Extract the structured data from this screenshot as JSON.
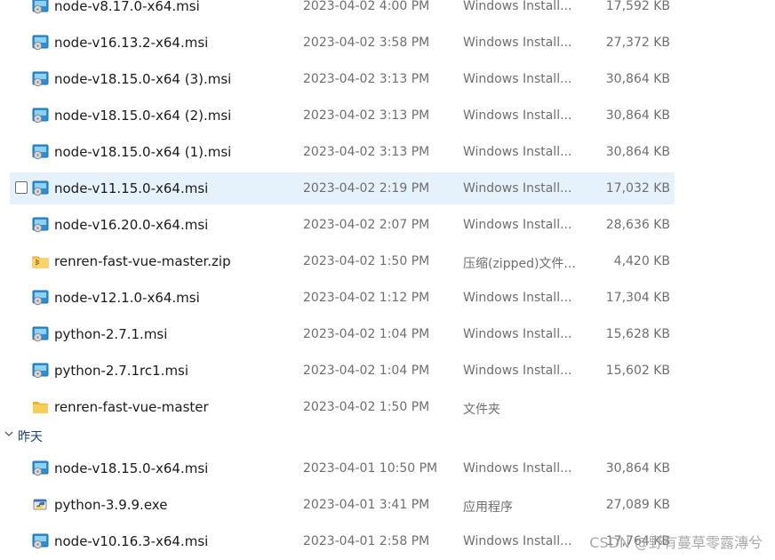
{
  "group": {
    "label": "昨天"
  },
  "files": [
    {
      "name": "node-v8.17.0-x64.msi",
      "date": "2023-04-02 4:00 PM",
      "type": "Windows Install...",
      "size": "17,592 KB",
      "icon": "msi-icon"
    },
    {
      "name": "node-v16.13.2-x64.msi",
      "date": "2023-04-02 3:58 PM",
      "type": "Windows Install...",
      "size": "27,372 KB",
      "icon": "msi-icon"
    },
    {
      "name": "node-v18.15.0-x64 (3).msi",
      "date": "2023-04-02 3:13 PM",
      "type": "Windows Install...",
      "size": "30,864 KB",
      "icon": "msi-icon"
    },
    {
      "name": "node-v18.15.0-x64 (2).msi",
      "date": "2023-04-02 3:13 PM",
      "type": "Windows Install...",
      "size": "30,864 KB",
      "icon": "msi-icon"
    },
    {
      "name": "node-v18.15.0-x64 (1).msi",
      "date": "2023-04-02 3:13 PM",
      "type": "Windows Install...",
      "size": "30,864 KB",
      "icon": "msi-icon"
    },
    {
      "name": "node-v11.15.0-x64.msi",
      "date": "2023-04-02 2:19 PM",
      "type": "Windows Install...",
      "size": "17,032 KB",
      "icon": "msi-icon",
      "hover": true
    },
    {
      "name": "node-v16.20.0-x64.msi",
      "date": "2023-04-02 2:07 PM",
      "type": "Windows Install...",
      "size": "28,636 KB",
      "icon": "msi-icon"
    },
    {
      "name": "renren-fast-vue-master.zip",
      "date": "2023-04-02 1:50 PM",
      "type": "压缩(zipped)文件...",
      "size": "4,420 KB",
      "icon": "zip-folder-icon"
    },
    {
      "name": "node-v12.1.0-x64.msi",
      "date": "2023-04-02 1:12 PM",
      "type": "Windows Install...",
      "size": "17,304 KB",
      "icon": "msi-icon"
    },
    {
      "name": "python-2.7.1.msi",
      "date": "2023-04-02 1:04 PM",
      "type": "Windows Install...",
      "size": "15,628 KB",
      "icon": "msi-icon"
    },
    {
      "name": "python-2.7.1rc1.msi",
      "date": "2023-04-02 1:04 PM",
      "type": "Windows Install...",
      "size": "15,602 KB",
      "icon": "msi-icon"
    },
    {
      "name": "renren-fast-vue-master",
      "date": "2023-04-02 1:50 PM",
      "type": "文件夹",
      "size": "",
      "icon": "folder-icon"
    },
    {
      "name": "node-v18.15.0-x64.msi",
      "date": "2023-04-01 10:50 PM",
      "type": "Windows Install...",
      "size": "30,864 KB",
      "icon": "msi-icon"
    },
    {
      "name": "python-3.9.9.exe",
      "date": "2023-04-01 3:41 PM",
      "type": "应用程序",
      "size": "27,089 KB",
      "icon": "exe-icon"
    },
    {
      "name": "node-v10.16.3-x64.msi",
      "date": "2023-04-01 2:58 PM",
      "type": "Windows Install...",
      "size": "17,764 KB",
      "icon": "msi-icon"
    }
  ],
  "watermark": "CSDN @野有蔓草零露漙兮",
  "colors": {
    "hover": "#e5f1fb",
    "secondary_text": "#6e6e6e",
    "group_text": "#1c3f7a"
  }
}
